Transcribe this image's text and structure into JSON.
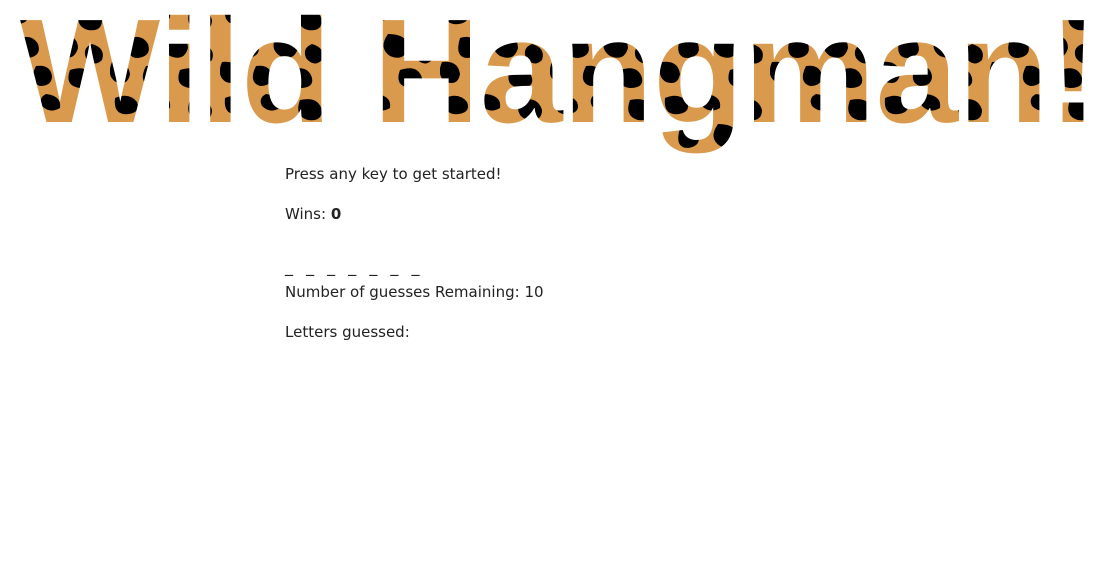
{
  "title": "Wild Hangman!",
  "title_pattern": {
    "base_color": "#d99a4e",
    "spot_color": "#000000",
    "name": "leopard-print"
  },
  "instructions": "Press any key to get started!",
  "wins": {
    "label": "Wins:",
    "value": "0"
  },
  "word_blanks": "_ _ _ _ _ _ _",
  "guesses_remaining": {
    "label": "Number of guesses Remaining:",
    "value": "10"
  },
  "letters_guessed": {
    "label": "Letters guessed:",
    "value": ""
  }
}
